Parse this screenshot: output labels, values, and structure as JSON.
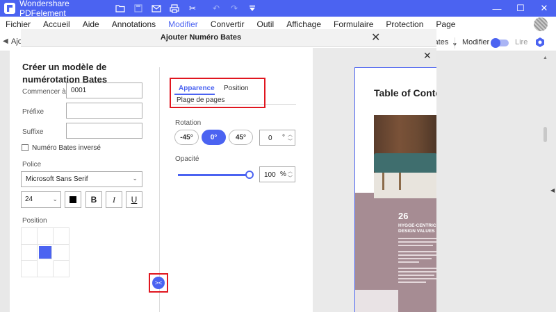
{
  "app": {
    "title": "Wondershare PDFelement",
    "window_controls": [
      "—",
      "☐",
      "✕"
    ]
  },
  "menu": [
    {
      "label": "Fichier"
    },
    {
      "label": "Accueil"
    },
    {
      "label": "Aide"
    },
    {
      "label": "Annotations"
    },
    {
      "label": "Modifier",
      "active": true
    },
    {
      "label": "Convertir"
    },
    {
      "label": "Outil"
    },
    {
      "label": "Affichage"
    },
    {
      "label": "Formulaire"
    },
    {
      "label": "Protection"
    },
    {
      "label": "Page"
    }
  ],
  "toolbar": {
    "left_label": "Ajo",
    "bates_label": "Numéro Bates",
    "modifier_label": "Modifier",
    "lire_label": "Lire"
  },
  "modal": {
    "title": "Ajouter Numéro Bates",
    "close": "✕",
    "heading": "Créer un modèle de numérotation Bates",
    "fields": {
      "start_label": "Commencer à",
      "start_value": "0001",
      "prefix_label": "Préfixe",
      "prefix_value": "",
      "suffix_label": "Suffixe",
      "suffix_value": ""
    },
    "reverse_label": "Numéro Bates inversé",
    "font_label": "Police",
    "font_value": "Microsoft Sans Serif",
    "size_value": "24",
    "format_buttons": {
      "bold": "B",
      "italic": "I",
      "underline": "U"
    },
    "position_label": "Position",
    "collapse_icon": "><"
  },
  "tabs": {
    "appearance": "Apparence",
    "position": "Position",
    "page_range": "Plage de pages"
  },
  "rotation": {
    "label": "Rotation",
    "options": [
      "-45°",
      "0°",
      "45°"
    ],
    "selected": "0°",
    "value": "0",
    "unit": "°"
  },
  "opacity": {
    "label": "Opacité",
    "value": "100",
    "unit": "%",
    "level": 1.0
  },
  "preview": {
    "close": "✕",
    "doc_title": "Table of Conte",
    "page_number": "26",
    "subtitle_line1": "HYGGE-CENTRIC",
    "subtitle_line2": "DESIGN VALUES"
  },
  "colors": {
    "accent": "#4b63f1",
    "highlight": "#e0161f"
  }
}
